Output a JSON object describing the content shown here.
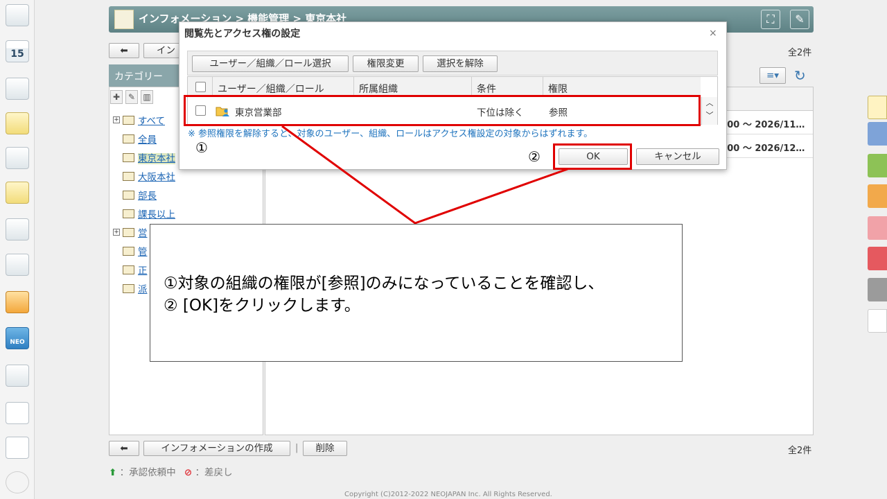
{
  "header": {
    "breadcrumb": "インフォメーション > 機能管理 > 東京本社"
  },
  "toolbar_top": {
    "back_label": "",
    "create_label_partial": "イン",
    "count": "全2件"
  },
  "category": {
    "heading": "カテゴリー",
    "items": [
      {
        "label": "すべて",
        "expandable": true,
        "selected": false
      },
      {
        "label": "全員",
        "expandable": false,
        "selected": false
      },
      {
        "label": "東京本社",
        "expandable": false,
        "selected": true
      },
      {
        "label": "大阪本社",
        "expandable": false,
        "selected": false
      },
      {
        "label": "部長",
        "expandable": false,
        "selected": false
      },
      {
        "label": "課長以上",
        "expandable": false,
        "selected": false
      },
      {
        "label": "営",
        "expandable": true,
        "selected": false
      },
      {
        "label": "管",
        "expandable": false,
        "selected": false
      },
      {
        "label": "正",
        "expandable": false,
        "selected": false
      },
      {
        "label": "派",
        "expandable": false,
        "selected": false
      }
    ]
  },
  "list": {
    "rows": [
      {
        "date_text": ":00 ～ 2026/11…"
      },
      {
        "date_text": ":00 ～ 2026/12…"
      }
    ]
  },
  "toolbar_bottom": {
    "create_label": "インフォメーションの作成",
    "separator": "|",
    "delete_label": "削除",
    "count": "全2件"
  },
  "legend": {
    "pending_label": "：承認依頼中",
    "rejected_label": "：差戻し"
  },
  "footer": {
    "copyright": "Copyright (C)2012-2022 NEOJAPAN Inc. All Rights Reserved."
  },
  "modal": {
    "title": "閲覧先とアクセス権の設定",
    "close_label": "×",
    "buttons": {
      "select": "ユーザー／組織／ロール選択",
      "change": "権限変更",
      "clear": "選択を解除"
    },
    "columns": [
      "ユーザー／組織／ロール",
      "所属組織",
      "条件",
      "権限"
    ],
    "row": {
      "name": "東京営業部",
      "org": "",
      "condition": "下位は除く",
      "permission": "参照"
    },
    "note": "※ 参照権限を解除すると、対象のユーザー、組織、ロールはアクセス権設定の対象からはずれます。",
    "ok_label": "OK",
    "cancel_label": "キャンセル"
  },
  "annotation": {
    "marker1": "①",
    "marker2": "②",
    "line1": "①対象の組織の権限が[参照]のみになっていることを確認し、",
    "line2": "② [OK]をクリックします。",
    "highlight_color": "#e00000"
  },
  "rail": {
    "calendar_day": "15",
    "neo_label": "NEO"
  },
  "icons": [
    "back-icon",
    "wrench-icon",
    "expand-icon",
    "refresh-icon",
    "menu-icon",
    "folder-icon",
    "org-icon",
    "plus-icon",
    "pencil-icon",
    "trash-icon",
    "gear-icon"
  ]
}
